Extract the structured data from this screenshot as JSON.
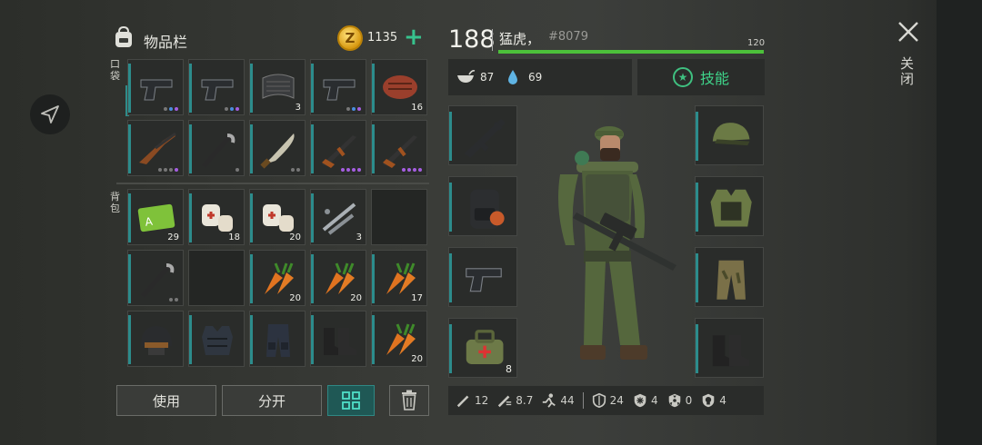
{
  "header": {
    "inventory_title": "物品栏",
    "coin_symbol": "Z",
    "coins": "1135",
    "add_symbol": "+"
  },
  "sections": {
    "pockets": "口袋",
    "backpack": "背包"
  },
  "pocket_items": [
    {
      "icon": "pistol-icon",
      "count": "",
      "rarity": [
        "gray",
        "blue",
        "purple"
      ]
    },
    {
      "icon": "pistol-icon",
      "count": "",
      "rarity": [
        "gray",
        "blue",
        "purple"
      ]
    },
    {
      "icon": "fabric-roll-icon",
      "count": "3",
      "rarity": []
    },
    {
      "icon": "pistol-icon",
      "count": "",
      "rarity": [
        "gray",
        "blue",
        "purple"
      ]
    },
    {
      "icon": "steak-icon",
      "count": "16",
      "rarity": []
    },
    {
      "icon": "shotgun-icon",
      "count": "",
      "rarity": [
        "gray",
        "gray",
        "gray",
        "purple"
      ]
    },
    {
      "icon": "crowbar-icon",
      "count": "",
      "rarity": [
        "gray"
      ]
    },
    {
      "icon": "machete-icon",
      "count": "",
      "rarity": [
        "gray",
        "gray"
      ]
    },
    {
      "icon": "rifle-icon",
      "count": "",
      "rarity": [
        "purple",
        "purple",
        "purple",
        "purple"
      ]
    },
    {
      "icon": "rifle-icon",
      "count": "",
      "rarity": [
        "purple",
        "purple",
        "purple",
        "purple"
      ]
    }
  ],
  "backpack_items": [
    {
      "icon": "access-card-icon",
      "count": "29",
      "rarity": []
    },
    {
      "icon": "bandage-icon",
      "count": "18",
      "rarity": []
    },
    {
      "icon": "bandage-icon",
      "count": "20",
      "rarity": []
    },
    {
      "icon": "pipe-parts-icon",
      "count": "3",
      "rarity": []
    },
    {
      "icon": "empty-slot",
      "count": "",
      "rarity": []
    },
    {
      "icon": "crowbar-icon",
      "count": "",
      "rarity": [
        "gray",
        "gray"
      ]
    },
    {
      "icon": "empty-slot",
      "count": "",
      "rarity": []
    },
    {
      "icon": "carrot-icon",
      "count": "20",
      "rarity": []
    },
    {
      "icon": "carrot-icon",
      "count": "20",
      "rarity": []
    },
    {
      "icon": "carrot-icon",
      "count": "17",
      "rarity": []
    },
    {
      "icon": "helmet-icon",
      "count": "",
      "rarity": []
    },
    {
      "icon": "armor-vest-icon",
      "count": "",
      "rarity": []
    },
    {
      "icon": "armor-pants-icon",
      "count": "",
      "rarity": []
    },
    {
      "icon": "boots-icon",
      "count": "",
      "rarity": []
    },
    {
      "icon": "carrot-icon",
      "count": "20",
      "rarity": []
    }
  ],
  "buttons": {
    "use": "使用",
    "split": "分开",
    "grid_icon": "grid-view-icon",
    "trash_icon": "trash-icon"
  },
  "character": {
    "level": "188",
    "name": "猛虎，",
    "id": "#8079",
    "xp_max": "120",
    "xp_fraction": 1.0,
    "hunger": "87",
    "thirst": "69",
    "skills_label": "技能",
    "equip_left": [
      {
        "icon": "assault-rifle-icon",
        "count": ""
      },
      {
        "icon": "backpack-icon",
        "count": ""
      },
      {
        "icon": "pistol-icon",
        "count": ""
      },
      {
        "icon": "medkit-icon",
        "count": "8"
      }
    ],
    "equip_right": [
      {
        "icon": "camo-cap-icon"
      },
      {
        "icon": "camo-jacket-icon"
      },
      {
        "icon": "camo-pants-icon"
      },
      {
        "icon": "boots-icon"
      }
    ]
  },
  "stats": [
    {
      "icon": "melee-damage-icon",
      "value": "12"
    },
    {
      "icon": "attack-speed-icon",
      "value": "8.7"
    },
    {
      "icon": "movement-icon",
      "value": "44"
    },
    {
      "icon": "armor-icon",
      "value": "24"
    },
    {
      "icon": "cold-resist-icon",
      "value": "4"
    },
    {
      "icon": "radiation-icon",
      "value": "0"
    },
    {
      "icon": "toxic-icon",
      "value": "4"
    }
  ],
  "close": {
    "label": "关闭"
  },
  "colors": {
    "accent": "#2c8c8c",
    "xp_green": "#4cc03a",
    "skills_green": "#3fd48a",
    "coin_gold": "#e0a316"
  }
}
